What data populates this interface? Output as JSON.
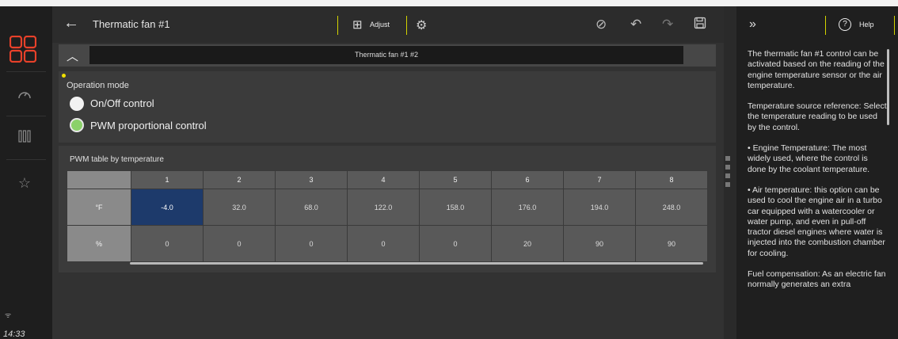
{
  "header": {
    "back_icon": "arrow-left-icon",
    "title": "Thermatic fan #1",
    "adjust_label": "Adjust"
  },
  "subbar": {
    "tab_label": "Thermatic fan #1 #2"
  },
  "operation": {
    "label": "Operation mode",
    "options": [
      {
        "label": "On/Off control",
        "selected": false
      },
      {
        "label": "PWM proportional control",
        "selected": true
      }
    ]
  },
  "pwm_table": {
    "label": "PWM table by temperature",
    "columns": [
      "1",
      "2",
      "3",
      "4",
      "5",
      "6",
      "7",
      "8"
    ],
    "rows": [
      {
        "unit": "°F",
        "values": [
          "-4.0",
          "32.0",
          "68.0",
          "122.0",
          "158.0",
          "176.0",
          "194.0",
          "248.0"
        ]
      },
      {
        "unit": "%",
        "values": [
          "0",
          "0",
          "0",
          "0",
          "0",
          "20",
          "90",
          "90"
        ]
      }
    ],
    "selected_cell": "row 0, col 0"
  },
  "sidebar": {
    "time": "14:33"
  },
  "help": {
    "button_label": "Help",
    "paragraphs": [
      "The thermatic fan #1 control can be activated based on the reading of the engine temperature sensor or the air temperature.",
      "Temperature source reference: Select the temperature reading to be used by the control.",
      "• Engine Temperature: The most widely used, where the control is done by the coolant temperature.",
      "• Air temperature: this option can be used to cool the engine air in a turbo car equipped with a watercooler or water pump, and even in pull-off tractor diesel engines where water is injected into the combustion chamber for cooling.",
      "Fuel compensation: As an electric fan normally generates an extra"
    ]
  },
  "colors": {
    "accent_yellow": "#d4d400",
    "selected_cell": "#1d3a6b",
    "radio_selected": "#8bd16a",
    "logo": "#e8412a"
  }
}
